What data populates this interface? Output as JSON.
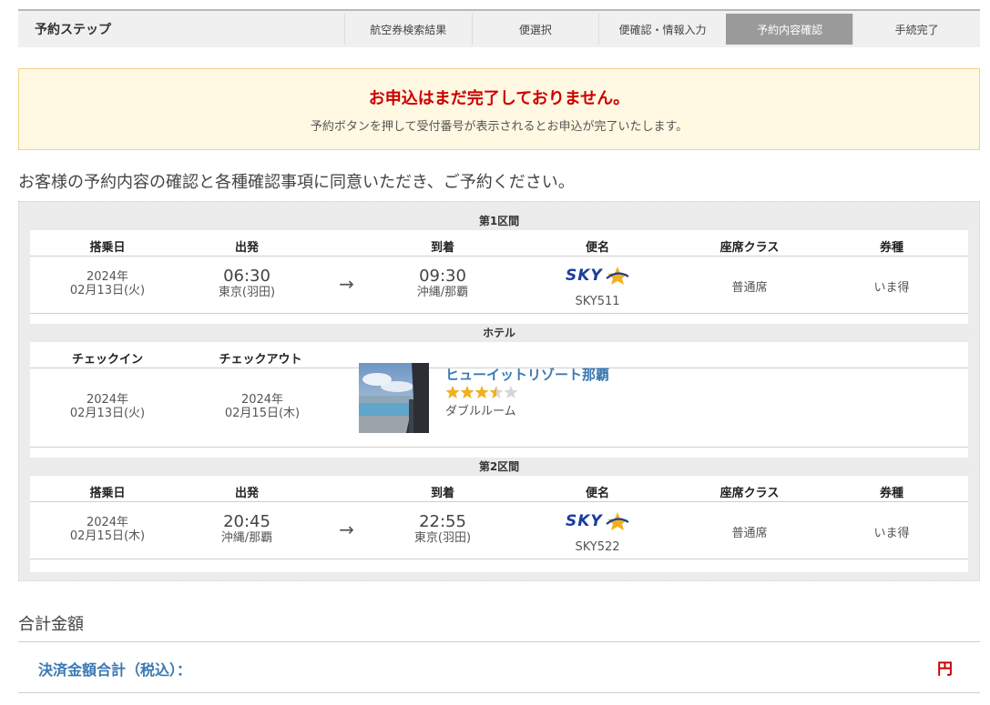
{
  "stepbar": {
    "title": "予約ステップ",
    "steps": [
      {
        "label": "航空券検索結果",
        "active": false
      },
      {
        "label": "便選択",
        "active": false
      },
      {
        "label": "便確認・情報入力",
        "active": false
      },
      {
        "label": "予約内容確認",
        "active": true
      },
      {
        "label": "手続完了",
        "active": false
      }
    ]
  },
  "notice": {
    "headline": "お申込はまだ完了しておりません。",
    "subtext": "予約ボタンを押して受付番号が表示されるとお申込が完了いたします。"
  },
  "lead_text": "お客様の予約内容の確認と各種確認事項に同意いただき、ご予約ください。",
  "flight_columns": {
    "date": "搭乗日",
    "departure": "出発",
    "arrival": "到着",
    "flight": "便名",
    "seat_class": "座席クラス",
    "fare_type": "券種"
  },
  "segment1": {
    "title": "第1区間",
    "date_year": "2024年",
    "date_day": "02月13日(火)",
    "dep_time": "06:30",
    "dep_place": "東京(羽田)",
    "arrow": "→",
    "arr_time": "09:30",
    "arr_place": "沖縄/那覇",
    "airline_logo": "SKY",
    "flight_no": "SKY511",
    "seat_class": "普通席",
    "fare_type": "いま得"
  },
  "hotel": {
    "title": "ホテル",
    "checkin_label": "チェックイン",
    "checkout_label": "チェックアウト",
    "checkin_year": "2024年",
    "checkin_day": "02月13日(火)",
    "checkout_year": "2024年",
    "checkout_day": "02月15日(木)",
    "name": "ヒューイットリゾート那覇",
    "rating": 3.5,
    "rating_max": 5,
    "room": "ダブルルーム"
  },
  "segment2": {
    "title": "第2区間",
    "date_year": "2024年",
    "date_day": "02月15日(木)",
    "dep_time": "20:45",
    "dep_place": "沖縄/那覇",
    "arrow": "→",
    "arr_time": "22:55",
    "arr_place": "東京(羽田)",
    "airline_logo": "SKY",
    "flight_no": "SKY522",
    "seat_class": "普通席",
    "fare_type": "いま得"
  },
  "total": {
    "section_label": "合計金額",
    "pay_label": "決済金額合計（税込）：",
    "unit": "円"
  },
  "colors": {
    "accent_red": "#cc0000",
    "link_blue": "#3a78b3",
    "sky_blue": "#1a3e9c",
    "star_gold": "#f2b01e"
  }
}
